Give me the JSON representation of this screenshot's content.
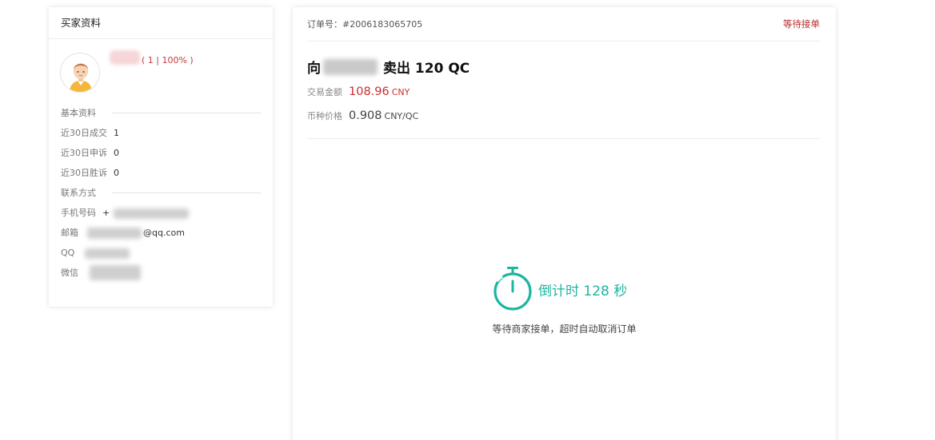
{
  "buyer": {
    "card_title": "买家资料",
    "stats": "( 1 | 100% )",
    "basic_section": "基本资料",
    "trades_30d_label": "近30日成交",
    "trades_30d_value": "1",
    "appeals_30d_label": "近30日申诉",
    "appeals_30d_value": "0",
    "wins_30d_label": "近30日胜诉",
    "wins_30d_value": "0",
    "contact_section": "联系方式",
    "phone_label": "手机号码",
    "phone_value": "+",
    "email_label": "邮箱",
    "email_value": "@qq.com",
    "qq_label": "QQ",
    "wechat_label": "微信"
  },
  "order": {
    "order_no": "订单号：#2006183065705",
    "status": "等待接单",
    "title_prefix": "向",
    "title_suffix": "卖出 120 QC",
    "amount_label": "交易金额",
    "amount_value": "108.96",
    "amount_unit": "CNY",
    "price_label": "币种价格",
    "price_value": "0.908",
    "price_unit": "CNY/QC",
    "countdown": "倒计时 128 秒",
    "countdown_hint": "等待商家接单，超时自动取消订单"
  },
  "colors": {
    "accent_red": "#c92e2e",
    "countdown_teal": "#1fb5a0"
  },
  "icons": {
    "avatar": "user-avatar-icon",
    "timer": "stopwatch-icon"
  }
}
